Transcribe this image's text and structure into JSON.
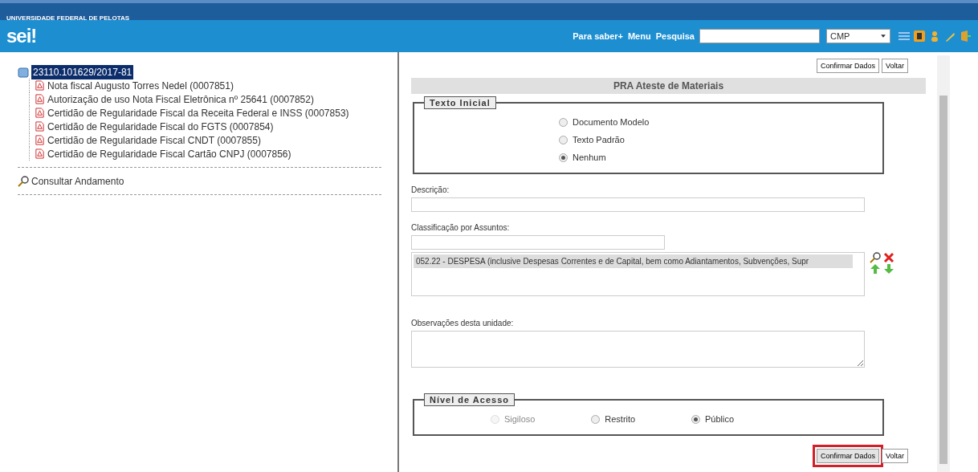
{
  "header": {
    "institution": "UNIVERSIDADE FEDERAL DE PELOTAS",
    "logo": "sei!",
    "links": [
      "Para saber+",
      "Menu",
      "Pesquisa"
    ],
    "unit_select": "CMP"
  },
  "tree": {
    "process": {
      "label": "23110.101629/2017-81",
      "selected": true
    },
    "documents": [
      {
        "label": "Nota fiscal Augusto Torres Nedel (0007851)"
      },
      {
        "label": "Autorização de uso Nota Fiscal Eletrônica nº 25641 (0007852)"
      },
      {
        "label": "Certidão de Regularidade Fiscal da Receita Federal e INSS (0007853)"
      },
      {
        "label": "Certidão de Regularidade Fiscal do FGTS (0007854)"
      },
      {
        "label": "Certidão de Regularidade Fiscal CNDT (0007855)"
      },
      {
        "label": "Certidão de Regularidade Fiscal Cartão CNPJ (0007856)"
      }
    ],
    "action": "Consultar Andamento"
  },
  "form": {
    "top_buttons": [
      {
        "label": "Confirmar Dados",
        "highlighted": false
      },
      {
        "label": "Voltar",
        "highlighted": false
      }
    ],
    "title": "PRA Ateste de Materiais",
    "texto_inicial": {
      "legend": "Texto Inicial",
      "options": [
        {
          "label": "Documento Modelo",
          "selected": false,
          "disabled": false
        },
        {
          "label": "Texto Padrão",
          "selected": false,
          "disabled": false
        },
        {
          "label": "Nenhum",
          "selected": true,
          "disabled": false
        }
      ]
    },
    "descricao_label": "Descrição:",
    "classificacao_label": "Classificação por Assuntos:",
    "assuntos": [
      "052.22 - DESPESA (inclusive Despesas Correntes e de Capital, bem como Adiantamentos, Subvenções, Supr"
    ],
    "observacoes_label": "Observações desta unidade:",
    "nivel_acesso": {
      "legend": "Nível de Acesso",
      "options": [
        {
          "label": "Sigiloso",
          "selected": false,
          "disabled": true
        },
        {
          "label": "Restrito",
          "selected": false,
          "disabled": false
        },
        {
          "label": "Público",
          "selected": true,
          "disabled": false
        }
      ]
    },
    "bottom_buttons": [
      {
        "label": "Confirmar Dados",
        "highlighted": true
      },
      {
        "label": "Voltar",
        "highlighted": false
      }
    ]
  }
}
